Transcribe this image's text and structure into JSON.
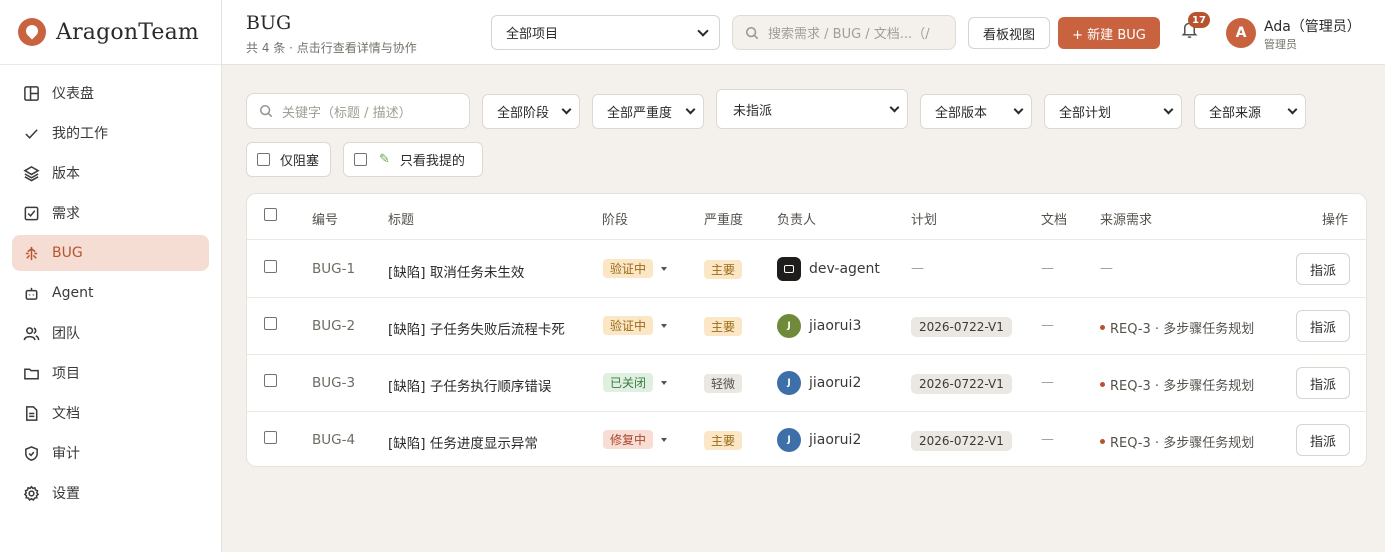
{
  "app": {
    "brand": "AragonTeam"
  },
  "sidebar": {
    "items": [
      {
        "label": "仪表盘",
        "icon": "dashboard-icon"
      },
      {
        "label": "我的工作",
        "icon": "check-icon"
      },
      {
        "label": "版本",
        "icon": "layers-icon"
      },
      {
        "label": "需求",
        "icon": "checkbox-icon"
      },
      {
        "label": "BUG",
        "icon": "bug-icon",
        "active": true
      },
      {
        "label": "Agent",
        "icon": "robot-icon"
      },
      {
        "label": "团队",
        "icon": "users-icon"
      },
      {
        "label": "项目",
        "icon": "folder-icon"
      },
      {
        "label": "文档",
        "icon": "document-icon"
      },
      {
        "label": "审计",
        "icon": "shield-icon"
      },
      {
        "label": "设置",
        "icon": "gear-icon"
      }
    ]
  },
  "header": {
    "title": "BUG",
    "subtitle": "共 4 条 · 点击行查看详情与协作",
    "project_select": "全部项目",
    "search_placeholder": "搜索需求 / BUG / 文档...（/",
    "kanban_button": "看板视图",
    "new_button": "+ 新建 BUG",
    "notification_count": "17",
    "user": {
      "initial": "A",
      "name": "Ada（管理员）",
      "role": "管理员"
    }
  },
  "filters": {
    "keyword_placeholder": "关键字（标题 / 描述）",
    "stage": "全部阶段",
    "severity": "全部严重度",
    "assignee": "未指派",
    "version": "全部版本",
    "plan": "全部计划",
    "source": "全部来源",
    "blocked_only": "仅阻塞",
    "mine_only": "只看我提的"
  },
  "table": {
    "headers": {
      "id": "编号",
      "title": "标题",
      "stage": "阶段",
      "severity": "严重度",
      "assignee": "负责人",
      "plan": "计划",
      "doc": "文档",
      "source": "来源需求",
      "action": "操作"
    },
    "rows": [
      {
        "id": "BUG-1",
        "title": "[缺陷] 取消任务未生效",
        "stage": "验证中",
        "severity": "主要",
        "assignee": "dev-agent",
        "assignee_type": "agent",
        "avatar_letter": "",
        "plan": "—",
        "doc": "—",
        "source": "—",
        "action": "指派"
      },
      {
        "id": "BUG-2",
        "title": "[缺陷] 子任务失败后流程卡死",
        "stage": "验证中",
        "severity": "主要",
        "assignee": "jiaorui3",
        "assignee_type": "user",
        "avatar_letter": "J",
        "plan": "2026-0722-V1",
        "doc": "—",
        "source": "REQ-3 · 多步骤任务规划",
        "action": "指派"
      },
      {
        "id": "BUG-3",
        "title": "[缺陷] 子任务执行顺序错误",
        "stage": "已关闭",
        "severity": "轻微",
        "assignee": "jiaorui2",
        "assignee_type": "user",
        "avatar_letter": "J",
        "plan": "2026-0722-V1",
        "doc": "—",
        "source": "REQ-3 · 多步骤任务规划",
        "action": "指派"
      },
      {
        "id": "BUG-4",
        "title": "[缺陷] 任务进度显示异常",
        "stage": "修复中",
        "severity": "主要",
        "assignee": "jiaorui2",
        "assignee_type": "user",
        "avatar_letter": "J",
        "plan": "2026-0722-V1",
        "doc": "—",
        "source": "REQ-3 · 多步骤任务规划",
        "action": "指派"
      }
    ]
  },
  "colors": {
    "accent": "#c8623f",
    "stage_verifying_bg": "#fbe7c6",
    "stage_closed_bg": "#dff0e0",
    "stage_fixing_bg": "#f8ddd4",
    "severity_major_bg": "#fbe7c6",
    "severity_minor_bg": "#ebe8e3",
    "avatar_olive": "#6f8a3b",
    "avatar_blue": "#3d6fa8"
  }
}
